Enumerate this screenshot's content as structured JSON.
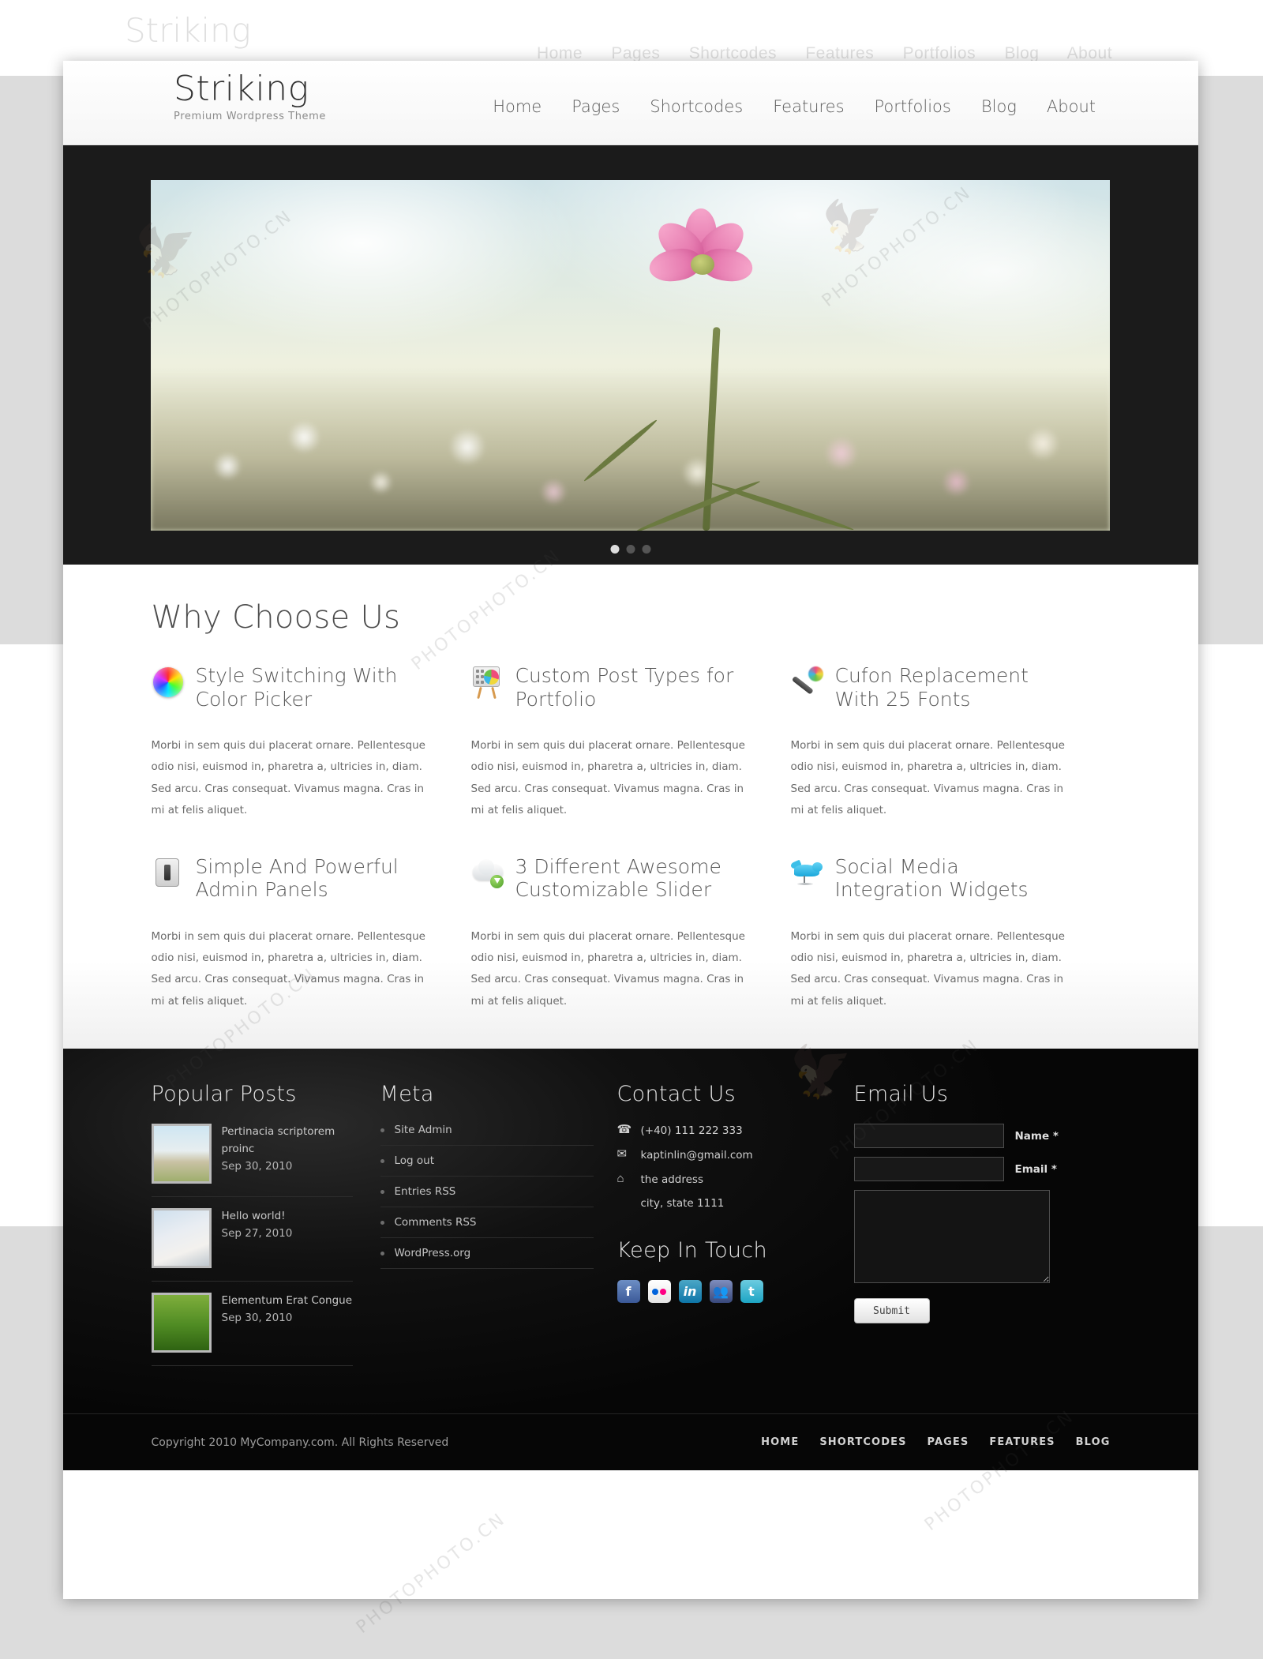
{
  "site": {
    "logo_name": "Striking",
    "logo_tagline": "Premium Wordpress Theme"
  },
  "topnav": {
    "items": [
      {
        "label": "Home"
      },
      {
        "label": "Pages"
      },
      {
        "label": "Shortcodes"
      },
      {
        "label": "Features"
      },
      {
        "label": "Portfolios"
      },
      {
        "label": "Blog"
      },
      {
        "label": "About"
      }
    ]
  },
  "slider": {
    "name": "flower-slider",
    "alt": "Pink cosmos flower against cloudy sky"
  },
  "why": {
    "title": "Why Choose Us",
    "body_text": "Morbi in sem quis dui placerat ornare. Pellentesque odio nisi, euismod in, pharetra a, ultricies in, diam. Sed arcu. Cras consequat. Vivamus magna. Cras in mi at felis aliquet.",
    "features": [
      {
        "icon": "color-wheel-icon",
        "title": "Style Switching With Color Picker"
      },
      {
        "icon": "easel-chart-icon",
        "title": "Custom Post Types for Portfolio"
      },
      {
        "icon": "magic-wand-icon",
        "title": "Cufon Replacement With 25 Fonts"
      },
      {
        "icon": "admin-switch-icon",
        "title": "Simple And Powerful Admin Panels"
      },
      {
        "icon": "cloud-download-icon",
        "title": "3 Different Awesome Customizable Slider"
      },
      {
        "icon": "twitter-bird-icon",
        "title": "Social Media Integration Widgets"
      }
    ]
  },
  "footer": {
    "popular_posts": {
      "title": "Popular Posts",
      "items": [
        {
          "title": "Pertinacia scriptorem proinc",
          "date": "Sep 30, 2010",
          "thumb": "cosmos-field-thumb"
        },
        {
          "title": "Hello world!",
          "date": "Sep 27, 2010",
          "thumb": "blossom-thumb"
        },
        {
          "title": "Elementum Erat Congue",
          "date": "Sep 30, 2010",
          "thumb": "grass-daisy-thumb"
        }
      ]
    },
    "meta": {
      "title": "Meta",
      "items": [
        {
          "label": "Site Admin"
        },
        {
          "label": "Log out"
        },
        {
          "label": "Entries RSS"
        },
        {
          "label": "Comments RSS"
        },
        {
          "label": "WordPress.org"
        }
      ]
    },
    "contact": {
      "title": "Contact Us",
      "phone": "(+40) 111 222 333",
      "email": "kaptinlin@gmail.com",
      "address_line1": "the address",
      "address_line2": "city, state  1111",
      "keep_in_touch_title": "Keep In Touch",
      "socials": [
        {
          "name": "facebook-icon",
          "glyph": "f"
        },
        {
          "name": "flickr-icon",
          "glyph": ""
        },
        {
          "name": "linkedin-icon",
          "glyph": "in"
        },
        {
          "name": "myspace-icon",
          "glyph": ""
        },
        {
          "name": "twitter-icon",
          "glyph": "t"
        }
      ]
    },
    "email_us": {
      "title": "Email Us",
      "name_label": "Name *",
      "name_value": "",
      "email_label": "Email *",
      "email_value": "",
      "message_value": "",
      "submit_label": "Submit"
    },
    "copyright": "Copyright  2010 MyCompany.com. All Rights Reserved",
    "nav": [
      {
        "label": "HOME"
      },
      {
        "label": "SHORTCODES"
      },
      {
        "label": "PAGES"
      },
      {
        "label": "FEATURES"
      },
      {
        "label": "BLOG"
      }
    ]
  },
  "colors": {
    "footer_bg": "#0a0a0a",
    "slider_bg": "#1b1b1b",
    "text_gray": "#5d5d5d"
  },
  "watermarks": {
    "text": "PHOTOPHOTO.CN"
  }
}
